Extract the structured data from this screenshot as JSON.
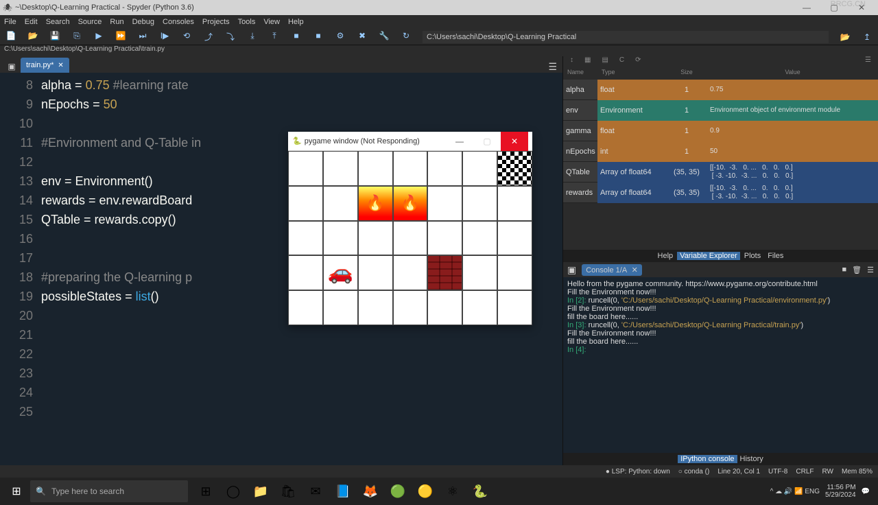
{
  "window": {
    "title": "~\\Desktop\\Q-Learning Practical - Spyder (Python 3.6)",
    "min": "—",
    "max": "▢",
    "close": "✕"
  },
  "menu": [
    "File",
    "Edit",
    "Search",
    "Source",
    "Run",
    "Debug",
    "Consoles",
    "Projects",
    "Tools",
    "View",
    "Help"
  ],
  "toolbar_icons": [
    "📄",
    "📂",
    "💾",
    "⎘",
    "▶",
    "⏩",
    "⏭",
    "I▶",
    "⟲",
    "⤴",
    "⤵",
    "⤓",
    "⤒",
    "■",
    "■",
    "⚙",
    "✖",
    "🔧",
    "↻"
  ],
  "path_input": "C:\\Users\\sachi\\Desktop\\Q-Learning Practical",
  "path_bread": "C:\\Users\\sachi\\Desktop\\Q-Learning Practical\\train.py",
  "editor": {
    "tab": "train.py*",
    "lines": [
      {
        "n": "8",
        "segs": [
          {
            "t": "alpha ",
            "c": "var"
          },
          {
            "t": "= ",
            "c": "op"
          },
          {
            "t": "0.75 ",
            "c": "num"
          },
          {
            "t": "#learning rate",
            "c": "cmt"
          }
        ]
      },
      {
        "n": "9",
        "segs": [
          {
            "t": "nEpochs ",
            "c": "var"
          },
          {
            "t": "= ",
            "c": "op"
          },
          {
            "t": "50",
            "c": "num"
          }
        ]
      },
      {
        "n": "10",
        "segs": []
      },
      {
        "n": "11",
        "segs": [
          {
            "t": "#Environment and Q-Table in",
            "c": "cmt"
          }
        ]
      },
      {
        "n": "12",
        "segs": []
      },
      {
        "n": "13",
        "segs": [
          {
            "t": "env ",
            "c": "var"
          },
          {
            "t": "= ",
            "c": "op"
          },
          {
            "t": "Environment",
            "c": "var"
          },
          {
            "t": "()",
            "c": "op"
          }
        ]
      },
      {
        "n": "14",
        "segs": [
          {
            "t": "rewards ",
            "c": "var"
          },
          {
            "t": "= ",
            "c": "op"
          },
          {
            "t": "env.rewardBoard",
            "c": "var"
          }
        ]
      },
      {
        "n": "15",
        "segs": [
          {
            "t": "QTable ",
            "c": "var"
          },
          {
            "t": "= ",
            "c": "op"
          },
          {
            "t": "rewards.copy",
            "c": "var"
          },
          {
            "t": "()",
            "c": "op"
          }
        ]
      },
      {
        "n": "16",
        "segs": []
      },
      {
        "n": "17",
        "segs": []
      },
      {
        "n": "18",
        "segs": [
          {
            "t": "#preparing the Q-learning p",
            "c": "cmt"
          }
        ]
      },
      {
        "n": "19",
        "segs": [
          {
            "t": "possibleStates ",
            "c": "var"
          },
          {
            "t": "= ",
            "c": "op"
          },
          {
            "t": "list",
            "c": "fn"
          },
          {
            "t": "()",
            "c": "op"
          }
        ]
      },
      {
        "n": "20",
        "segs": []
      },
      {
        "n": "21",
        "segs": []
      },
      {
        "n": "22",
        "segs": []
      },
      {
        "n": "23",
        "segs": []
      },
      {
        "n": "24",
        "segs": []
      },
      {
        "n": "25",
        "segs": []
      }
    ]
  },
  "varex": {
    "headers": [
      "Name",
      "Type",
      "Size",
      "Value"
    ],
    "rows": [
      {
        "name": "alpha",
        "type": "float",
        "size": "1",
        "val": "0.75",
        "tone": "orange"
      },
      {
        "name": "env",
        "type": "Environment",
        "size": "1",
        "val": "Environment object of environment module",
        "tone": "teal"
      },
      {
        "name": "gamma",
        "type": "float",
        "size": "1",
        "val": "0.9",
        "tone": "orange"
      },
      {
        "name": "nEpochs",
        "type": "int",
        "size": "1",
        "val": "50",
        "tone": "orange"
      },
      {
        "name": "QTable",
        "type": "Array of float64",
        "size": "(35, 35)",
        "val": "[[-10.  -3.   0. ...   0.   0.   0.]\n [ -3. -10.  -3. ...   0.   0.   0.]",
        "tone": "blue",
        "sel": true
      },
      {
        "name": "rewards",
        "type": "Array of float64",
        "size": "(35, 35)",
        "val": "[[-10.  -3.   0. ...   0.   0.   0.]\n [ -3. -10.  -3. ...   0.   0.   0.]",
        "tone": "blue"
      }
    ],
    "tabs": [
      "Help",
      "Variable Explorer",
      "Plots",
      "Files"
    ],
    "activeTab": "Variable Explorer"
  },
  "console": {
    "tab": "Console 1/A",
    "body_lines": [
      {
        "t": "Hello from the pygame community. https://www.pygame.org/contribute.html",
        "c": ""
      },
      {
        "t": "Fill the Environment now!!!",
        "c": ""
      },
      {
        "t": "",
        "c": ""
      },
      {
        "t": "In [2]: ",
        "c": "in",
        "after": "runcell(0, ",
        "str": "'C:/Users/sachi/Desktop/Q-Learning Practical/environment.py'",
        "end": ")"
      },
      {
        "t": "Fill the Environment now!!!",
        "c": ""
      },
      {
        "t": "fill the board here......",
        "c": ""
      },
      {
        "t": "",
        "c": ""
      },
      {
        "t": "In [3]: ",
        "c": "in",
        "after": "runcell(0, ",
        "str": "'C:/Users/sachi/Desktop/Q-Learning Practical/train.py'",
        "end": ")"
      },
      {
        "t": "Fill the Environment now!!!",
        "c": ""
      },
      {
        "t": "fill the board here......",
        "c": ""
      },
      {
        "t": "",
        "c": ""
      },
      {
        "t": "In [4]: ",
        "c": "in"
      }
    ],
    "bottom_tabs": [
      "IPython console",
      "History"
    ],
    "activeTab": "IPython console"
  },
  "status": {
    "lsp": "● LSP: Python: down",
    "env": "○ conda ()",
    "pos": "Line 20, Col 1",
    "enc": "UTF-8",
    "eol": "CRLF",
    "perm": "RW",
    "mem": "Mem 85%"
  },
  "taskbar": {
    "search_placeholder": "Type here to search",
    "icons": [
      "⊞",
      "◯",
      "📁",
      "🛍",
      "✉",
      "📘",
      "🦊",
      "🟢",
      "🟡",
      "⚛",
      "🐍"
    ],
    "tray": [
      "^",
      "☁",
      "🔊",
      "📶",
      "ENG"
    ],
    "time": "11:56 PM",
    "date": "5/29/2024"
  },
  "pygame": {
    "title": "pygame window (Not Responding)",
    "min": "—",
    "max": "▢",
    "close": "✕"
  },
  "watermark": "RRCG.CN"
}
